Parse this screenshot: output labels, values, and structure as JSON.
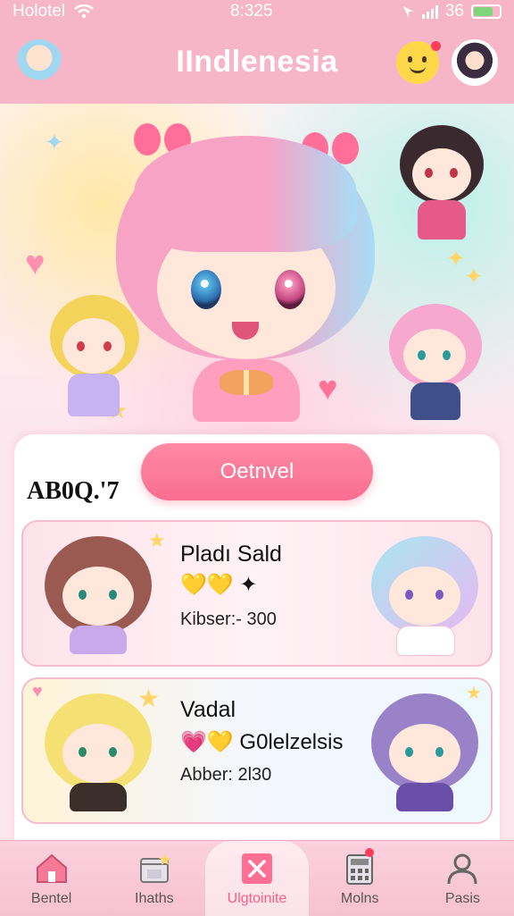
{
  "status_bar": {
    "carrier": "Holotel",
    "time": "8:325",
    "battery_text": "36"
  },
  "header": {
    "title": "IIndlenesia"
  },
  "main": {
    "cta_label": "Oetnvel",
    "section_label": "AB0Q.'7"
  },
  "list": [
    {
      "title": "Pladı Sald",
      "tags": "💛💛 ✦",
      "meta": "Kibser:- 300"
    },
    {
      "title": "Vadal",
      "tags": "💗💛 G0lelzelsis",
      "meta": "Abber: 2l30"
    }
  ],
  "bottom_nav": [
    {
      "label": "Bentel",
      "icon": "home-icon"
    },
    {
      "label": "Ihaths",
      "icon": "store-icon"
    },
    {
      "label": "Ulgtoinite",
      "icon": "close-box-icon"
    },
    {
      "label": "Molns",
      "icon": "calculator-icon"
    },
    {
      "label": "Pasis",
      "icon": "user-icon"
    }
  ],
  "colors": {
    "accent": "#f96d90",
    "header": "#f7b6c8",
    "active_nav": "#ff5c85"
  }
}
